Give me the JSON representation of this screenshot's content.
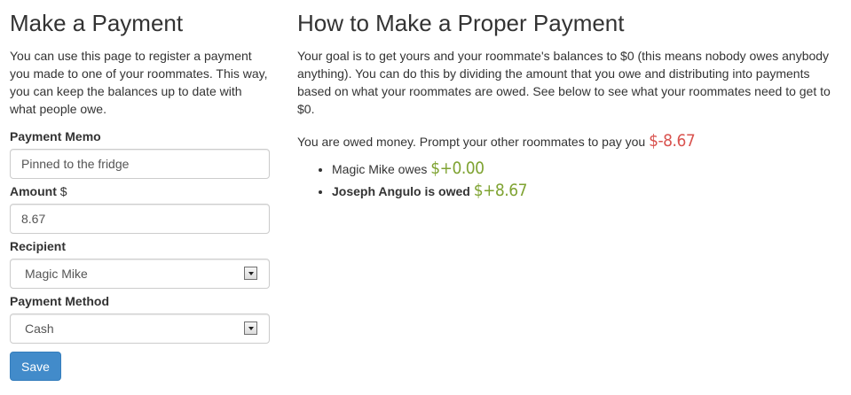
{
  "payment_form": {
    "title": "Make a Payment",
    "intro": "You can use this page to register a payment you made to one of your roommates. This way, you can keep the balances up to date with what people owe.",
    "memo_label": "Payment Memo",
    "memo_value": "Pinned to the fridge",
    "amount_label": "Amount",
    "amount_unit": "$",
    "amount_value": "8.67",
    "recipient_label": "Recipient",
    "recipient_value": "Magic Mike",
    "method_label": "Payment Method",
    "method_value": "Cash",
    "save_label": "Save"
  },
  "instructions": {
    "title": "How to Make a Proper Payment",
    "goal": "Your goal is to get yours and your roommate's balances to $0 (this means nobody owes anybody anything). You can do this by dividing the amount that you owe and distributing into payments based on what your roommates are owed. See below to see what your roommates need to get to $0.",
    "status_text": "You are owed money. Prompt your other roommates to pay you",
    "status_amount": "$-8.67",
    "balances": [
      {
        "text": "Magic Mike owes",
        "amount": "$+0.00"
      },
      {
        "text": "Joseph Angulo is owed",
        "amount": "$+8.67"
      }
    ]
  },
  "colors": {
    "primary_button": "#428bca",
    "negative_amount": "#d9534f",
    "positive_amount": "#7fa332"
  }
}
